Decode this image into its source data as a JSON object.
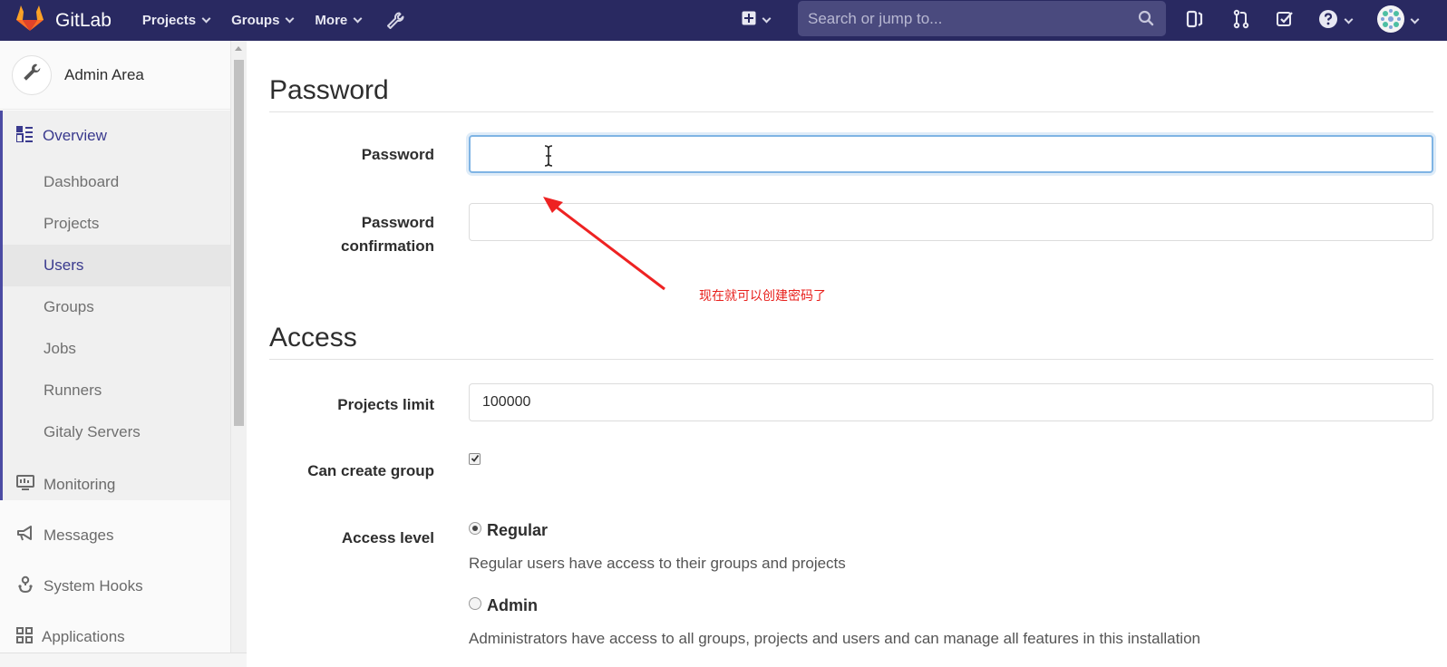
{
  "navbar": {
    "brand": "GitLab",
    "menu": [
      {
        "label": "Projects"
      },
      {
        "label": "Groups"
      },
      {
        "label": "More"
      }
    ],
    "search_placeholder": "Search or jump to..."
  },
  "sidebar": {
    "title": "Admin Area",
    "overview_label": "Overview",
    "overview_items": [
      {
        "label": "Dashboard",
        "active": false
      },
      {
        "label": "Projects",
        "active": false
      },
      {
        "label": "Users",
        "active": true
      },
      {
        "label": "Groups",
        "active": false
      },
      {
        "label": "Jobs",
        "active": false
      },
      {
        "label": "Runners",
        "active": false
      },
      {
        "label": "Gitaly Servers",
        "active": false
      }
    ],
    "items": [
      {
        "label": "Monitoring",
        "icon": "monitor-icon"
      },
      {
        "label": "Messages",
        "icon": "megaphone-icon"
      },
      {
        "label": "System Hooks",
        "icon": "hook-icon"
      },
      {
        "label": "Applications",
        "icon": "grid-icon"
      }
    ]
  },
  "password_section": {
    "title": "Password",
    "password_label": "Password",
    "password_value": "",
    "confirm_label_line1": "Password",
    "confirm_label_line2": "confirmation",
    "confirm_value": ""
  },
  "annotation": {
    "text": "现在就可以创建密码了",
    "color": "#e8201c"
  },
  "access_section": {
    "title": "Access",
    "projects_limit_label": "Projects limit",
    "projects_limit_value": "100000",
    "can_create_group_label": "Can create group",
    "can_create_group_checked": true,
    "access_level_label": "Access level",
    "regular_label": "Regular",
    "regular_help": "Regular users have access to their groups and projects",
    "regular_selected": true,
    "admin_label": "Admin",
    "admin_help": "Administrators have access to all groups, projects and users and can manage all features in this installation",
    "admin_selected": false
  },
  "colors": {
    "navbar_bg": "#292961",
    "accent": "#3a3a8e",
    "focus_border": "#7fb4e4"
  }
}
